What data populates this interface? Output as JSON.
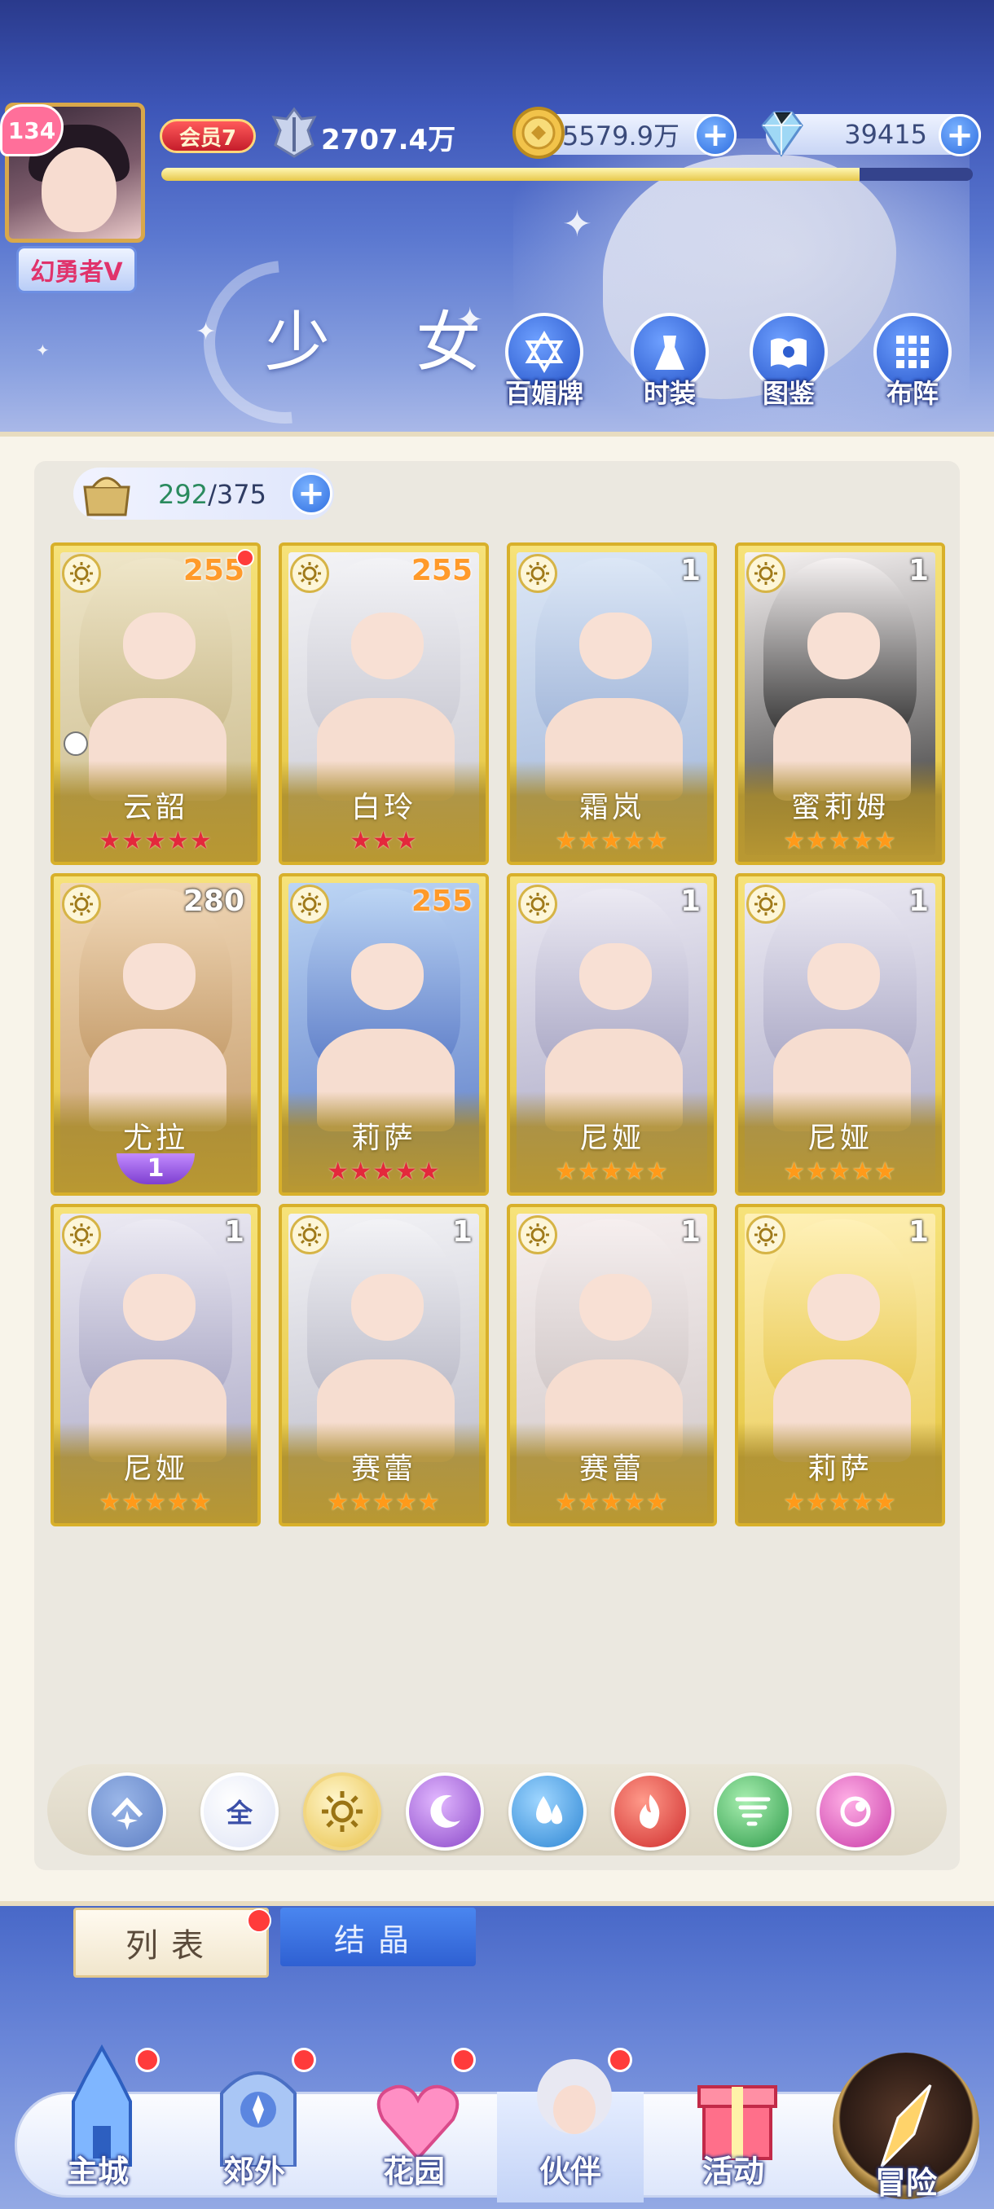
{
  "player": {
    "level": "134",
    "title": "幻勇者V",
    "vip": "会员7",
    "power": "2707.4万"
  },
  "resources": {
    "gold": "5579.9万",
    "gems": "39415"
  },
  "xp_progress": 0.86,
  "page": {
    "heading": "少 女"
  },
  "top_tools": [
    {
      "label": "百媚牌"
    },
    {
      "label": "时装"
    },
    {
      "label": "图鉴"
    },
    {
      "label": "布阵"
    }
  ],
  "capacity": {
    "current": "292",
    "separator": "/",
    "max": "375"
  },
  "cards": [
    {
      "name": "云韶",
      "level": "255",
      "stars": 5,
      "star_color": "red"
    },
    {
      "name": "白玲",
      "level": "255",
      "stars": 3,
      "star_color": "red"
    },
    {
      "name": "霜岚",
      "level": "1",
      "stars": 5,
      "star_color": "gold"
    },
    {
      "name": "蜜莉姆",
      "level": "1",
      "stars": 5,
      "star_color": "gold"
    },
    {
      "name": "尤拉",
      "level": "280",
      "rank": "1"
    },
    {
      "name": "莉萨",
      "level": "255",
      "stars": 5,
      "star_color": "red"
    },
    {
      "name": "尼娅",
      "level": "1",
      "stars": 5,
      "star_color": "gold"
    },
    {
      "name": "尼娅",
      "level": "1",
      "stars": 5,
      "star_color": "gold"
    },
    {
      "name": "尼娅",
      "level": "1",
      "stars": 5,
      "star_color": "gold"
    },
    {
      "name": "赛蕾",
      "level": "1",
      "stars": 5,
      "star_color": "gold"
    },
    {
      "name": "赛蕾",
      "level": "1",
      "stars": 5,
      "star_color": "gold"
    },
    {
      "name": "莉萨",
      "level": "1",
      "stars": 5,
      "star_color": "gold"
    }
  ],
  "filters": {
    "all_label": "全"
  },
  "tabs": {
    "list": "列表",
    "crystal": "结晶"
  },
  "nav": [
    {
      "label": "主城"
    },
    {
      "label": "郊外"
    },
    {
      "label": "花园"
    },
    {
      "label": "伙伴"
    },
    {
      "label": "活动"
    },
    {
      "label": "冒险"
    }
  ],
  "colors": {
    "accent_blue": "#2f6ee0",
    "card_gold": "#e3c23c",
    "notification_red": "#ff3b3b"
  }
}
